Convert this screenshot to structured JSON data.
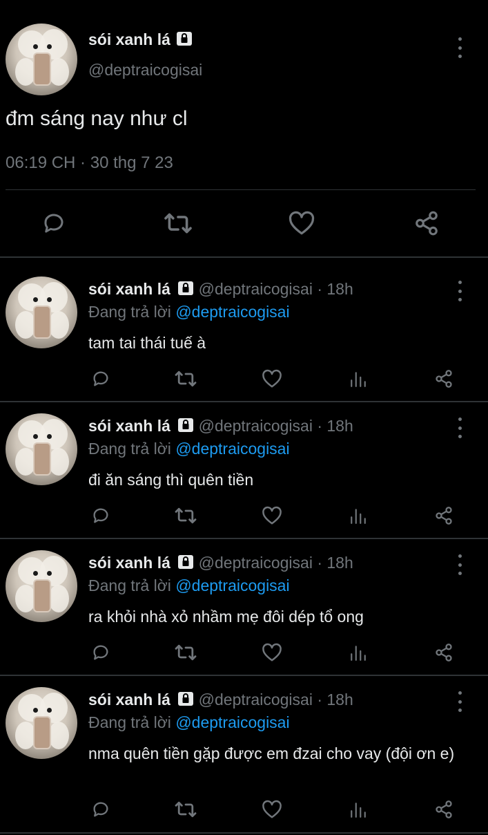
{
  "main_tweet": {
    "display_name": "sói xanh lá",
    "handle": "@deptraicogisai",
    "text": "đm sáng nay như cl",
    "timestamp": "06:19 CH · 30 thg 7 23",
    "actions": [
      "reply-icon",
      "retweet-icon",
      "like-icon",
      "share-icon"
    ]
  },
  "replies": [
    {
      "display_name": "sói xanh lá",
      "handle": "@deptraicogisai",
      "time": "· 18h",
      "replying_prefix": "Đang trả lời",
      "replying_to": "@deptraicogisai",
      "text": "tam tai thái tuế à"
    },
    {
      "display_name": "sói xanh lá",
      "handle": "@deptraicogisai",
      "time": "· 18h",
      "replying_prefix": "Đang trả lời",
      "replying_to": "@deptraicogisai",
      "text": "đi ăn sáng thì quên tiền"
    },
    {
      "display_name": "sói xanh lá",
      "handle": "@deptraicogisai",
      "time": "· 18h",
      "replying_prefix": "Đang trả lời",
      "replying_to": "@deptraicogisai",
      "text": "ra khỏi nhà xỏ nhầm mẹ đôi dép tổ ong"
    },
    {
      "display_name": "sói xanh lá",
      "handle": "@deptraicogisai",
      "time": "· 18h",
      "replying_prefix": "Đang trả lời",
      "replying_to": "@deptraicogisai",
      "text": "nma quên tiền gặp được em đzai cho vay (đội ơn e)"
    }
  ],
  "colors": {
    "background": "#000000",
    "text": "#e7e9ea",
    "secondary": "#71767b",
    "mention": "#1d9bf0",
    "divider": "#2f3336"
  }
}
